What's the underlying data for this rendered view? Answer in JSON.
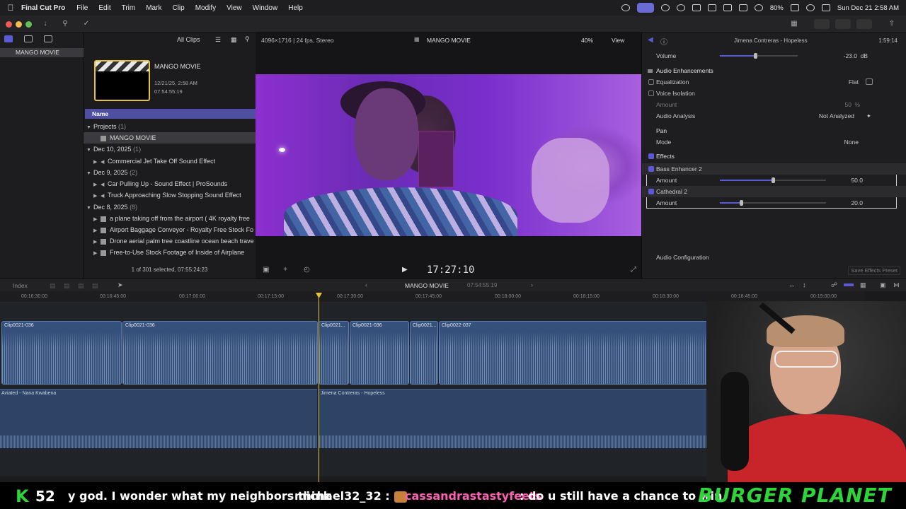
{
  "menubar": {
    "app": "Final Cut Pro",
    "items": [
      "File",
      "Edit",
      "Trim",
      "Mark",
      "Clip",
      "Modify",
      "View",
      "Window",
      "Help"
    ],
    "battery": "80%",
    "clock": "Sun Dec 21  2:58 AM"
  },
  "sidebar": {
    "library_item": "MANGO MOVIE"
  },
  "browser": {
    "filter": "All Clips",
    "project_title": "MANGO MOVIE",
    "project_date": "12/21/25, 2:58 AM",
    "project_duration": "07:54:55:19",
    "column_name": "Name",
    "groups": [
      {
        "label": "Projects",
        "count": "(1)",
        "items": [
          "MANGO MOVIE"
        ]
      },
      {
        "label": "Dec 10, 2025",
        "count": "(1)",
        "items": [
          "Commercial Jet Take Off Sound Effect"
        ]
      },
      {
        "label": "Dec 9, 2025",
        "count": "(2)",
        "items": [
          "Car Pulling Up - Sound Effect  |  ProSounds",
          "Truck Approaching Slow Stopping Sound Effect"
        ]
      },
      {
        "label": "Dec 8, 2025",
        "count": "(8)",
        "items": [
          "a plane taking off from the airport ( 4K royalty free",
          "Airport Baggage Conveyor - Royalty Free Stock Fo",
          "Drone aerial palm tree coastline ocean beach trave",
          "Free-to-Use Stock Footage of Inside of Airplane"
        ]
      }
    ],
    "selection_status": "1 of 301 selected, 07:55:24:23"
  },
  "viewer": {
    "format": "4096×1716 | 24 fps, Stereo",
    "title": "MANGO MOVIE",
    "zoom": "40%",
    "view_menu": "View",
    "timecode": "17:27:10"
  },
  "inspector": {
    "clip_name": "Jimena Contreras - Hopeless",
    "clip_duration": "1:59:14",
    "volume_label": "Volume",
    "volume_value": "-23.0",
    "volume_unit": "dB",
    "volume_level": 0.45,
    "enhancements_label": "Audio Enhancements",
    "equalization_label": "Equalization",
    "equalization_value": "Flat",
    "voice_isolation_label": "Voice Isolation",
    "amount_label": "Amount",
    "amount_value": "50",
    "amount_unit": "%",
    "analysis_label": "Audio Analysis",
    "analysis_value": "Not Analyzed",
    "pan_label": "Pan",
    "mode_label": "Mode",
    "mode_value": "None",
    "effects_label": "Effects",
    "effect1_name": "Bass Enhancer 2",
    "effect1_amount": "50.0",
    "effect1_level": 0.5,
    "effect2_name": "Cathedral 2",
    "effect2_amount": "20.0",
    "effect2_level": 0.2,
    "config_label": "Audio Configuration",
    "save_preset": "Save Effects Preset"
  },
  "timeline": {
    "index_label": "Index",
    "project_name": "MANGO MOVIE",
    "project_duration": "07:54:55:19",
    "ruler_ticks": [
      "00:16:30:00",
      "00:16:45:00",
      "00:17:00:00",
      "00:17:15:00",
      "00:17:30:00",
      "00:17:45:00",
      "00:18:00:00",
      "00:18:15:00",
      "00:18:30:00",
      "00:18:45:00",
      "00:19:00:00"
    ],
    "clips": [
      "Clip0021-036",
      "Clip0021-036",
      "Clip0021...",
      "Clip0021-036",
      "Clip0021...",
      "Clip0022-037",
      "Cl"
    ],
    "music_tracks": [
      "Aviated - Nana Kwabena",
      "Jimena Contreras - Hopeless"
    ]
  },
  "ticker": {
    "k_letter": "K",
    "k_number": "52",
    "message1": "y god. I wonder what my neighbors think",
    "user1": "michael32_32 :",
    "user2": "cassandrastastyfeets",
    "message2": ": do u still have a chance to win",
    "brand": "BURGER PLANET"
  },
  "colors": {
    "accent": "#5b5bd6",
    "playhead": "#e8c23a",
    "clip": "#35507a",
    "brand": "#2fd33a"
  }
}
